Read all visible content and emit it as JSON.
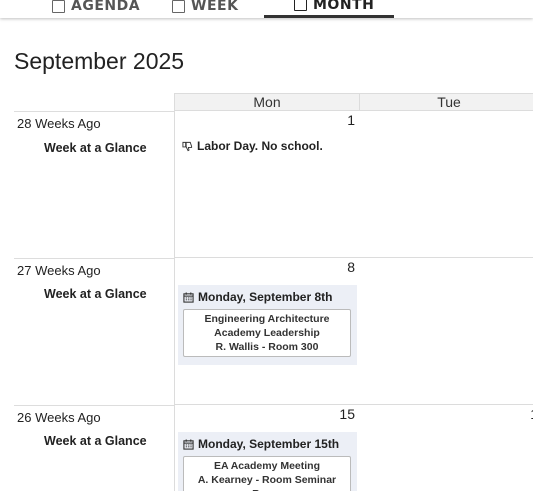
{
  "tabs": [
    {
      "label": "AGENDA"
    },
    {
      "label": "WEEK"
    },
    {
      "label": "MONTH"
    }
  ],
  "calendar_title": "September 2025",
  "columns": [
    "Mon",
    "Tue"
  ],
  "rows": [
    {
      "weeks_ago": "28 Weeks Ago",
      "glance": "Week at a Glance",
      "mon_day": "1",
      "holiday": "Labor Day. No school."
    },
    {
      "weeks_ago": "27 Weeks Ago",
      "glance": "Week at a Glance",
      "mon_day": "8",
      "event_date": "Monday, September 8th",
      "event_lines": [
        "Engineering Architecture",
        "Academy Leadership",
        "R. Wallis - Room 300"
      ]
    },
    {
      "weeks_ago": "26 Weeks Ago",
      "glance": "Week at a Glance",
      "mon_day": "15",
      "tue_day": "1",
      "event_date": "Monday, September 15th",
      "event_lines": [
        "EA Academy Meeting",
        "A. Kearney - Room Seminar Room"
      ]
    }
  ],
  "icons": {
    "tab": "calendar-icon",
    "holiday": "thumbs-down-icon",
    "event": "calendar-icon"
  },
  "colors": {
    "event_bg": "#eceff6",
    "header_bg": "#f2f2f2",
    "border": "#dcdcdc"
  }
}
